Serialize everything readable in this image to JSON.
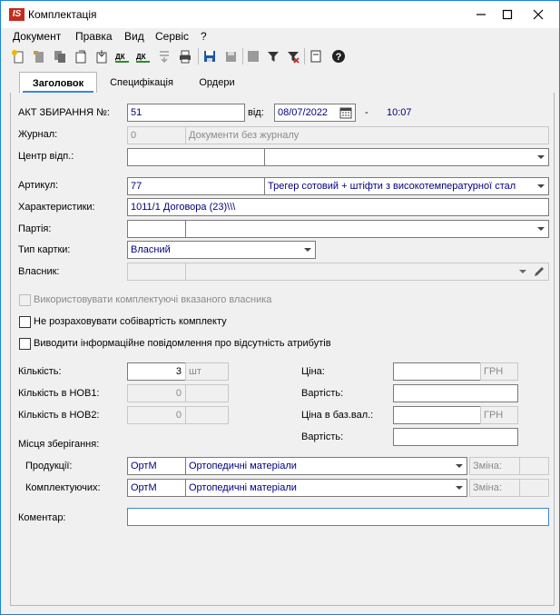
{
  "window": {
    "app_icon": "IS",
    "title": "Комплектація"
  },
  "menu": [
    "Документ",
    "Правка",
    "Вид",
    "Сервіс",
    "?"
  ],
  "toolbar_icons": [
    "add-document-icon",
    "edit-icon",
    "copy-icon",
    "clone-icon",
    "import-icon",
    "dk-up-icon",
    "dk-down-icon",
    "split-icon",
    "print-icon",
    "save-icon",
    "save-all-icon",
    "gray-square-icon",
    "filter-icon",
    "clear-filter-icon",
    "page-icon",
    "help-icon"
  ],
  "tabs": {
    "header": "Заголовок",
    "specification": "Специфікація",
    "orders": "Ордери"
  },
  "form": {
    "act_label": "АКТ ЗБИРАННЯ №:",
    "act_number": "51",
    "from_label": "від:",
    "date": "08/07/2022",
    "dash": "-",
    "time": "10:07",
    "journal_label": "Журнал:",
    "journal_code": "0",
    "journal_name": "Документи без журналу",
    "center_label": "Центр відп.:",
    "center_code": "",
    "center_name": "",
    "article_label": "Артикул:",
    "article_code": "77",
    "article_name": "Трегер сотовий + штіфти з високотемпературної стал",
    "characteristics_label": "Характеристики:",
    "characteristics_value": "1011/1 Договора (23)\\\\\\",
    "batch_label": "Партія:",
    "batch_code": "",
    "batch_name": "",
    "card_type_label": "Тип картки:",
    "card_type_value": "Власний",
    "owner_label": "Власник:",
    "owner_code": "",
    "owner_name": "",
    "cb_use_owner": "Використовувати комплектуючі вказаного власника",
    "cb_no_cost": "Не розраховувати собівартість комплекту",
    "cb_show_info": "Виводити інформаційне повідомлення про відсутність атрибутів",
    "qty_label": "Кількість:",
    "qty_value": "3",
    "qty_unit": "шт",
    "qty_nov1_label": "Кількість в НОВ1:",
    "qty_nov1_value": "0",
    "qty_nov1_unit": "",
    "qty_nov2_label": "Кількість в НОВ2:",
    "qty_nov2_value": "0",
    "qty_nov2_unit": "",
    "price_label": "Ціна:",
    "price_value": "",
    "price_currency": "ГРН",
    "cost_label": "Вартість:",
    "cost_value": "",
    "price_base_label": "Ціна в баз.вал.:",
    "price_base_value": "",
    "price_base_currency": "ГРН",
    "cost_base_label": "Вартість:",
    "cost_base_value": "",
    "storage_label": "Місця зберігання:",
    "products_label": "Продукції:",
    "products_code": "ОртМ",
    "products_name": "Ортопедичні матеріали",
    "products_change_label": "Зміна:",
    "products_change_value": "",
    "components_label": "Комплектуючих:",
    "components_code": "ОртМ",
    "components_name": "Ортопедичні матеріали",
    "components_change_label": "Зміна:",
    "components_change_value": "",
    "comment_label": "Коментар:",
    "comment_value": ""
  }
}
